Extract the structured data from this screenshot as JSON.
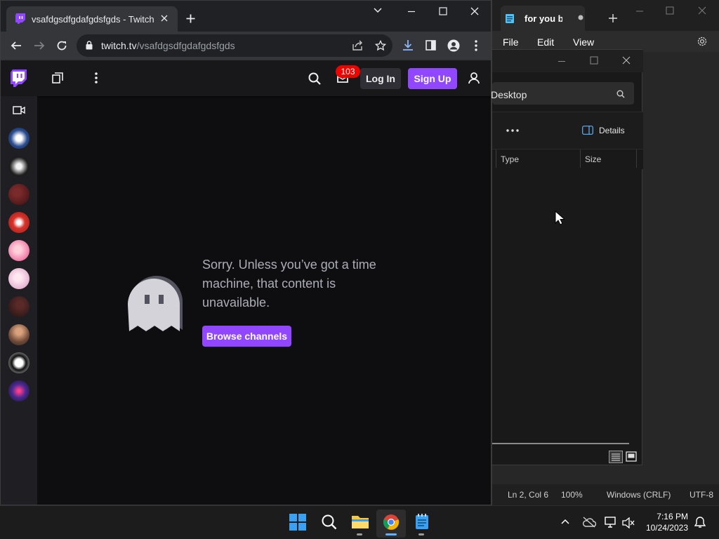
{
  "notepad": {
    "tab_title": "for you bro",
    "menu": {
      "file": "File",
      "edit": "Edit",
      "view": "View"
    },
    "status": {
      "position": "Ln 2, Col 6",
      "zoom": "100%",
      "line_ending": "Windows (CRLF)",
      "encoding": "UTF-8"
    }
  },
  "explorer": {
    "address": "Desktop",
    "toolbar": {
      "details_label": "Details"
    },
    "columns": [
      "Type",
      "Size"
    ]
  },
  "chrome": {
    "tab_title": "vsafdgsdfgdafgdsfgds - Twitch",
    "url_host": "twitch.tv",
    "url_path": "/vsafdgsdfgdafgdsfgds"
  },
  "twitch": {
    "notification_count": "103",
    "login_label": "Log In",
    "signup_label": "Sign Up",
    "message": "Sorry. Unless you’ve got a time machine, that content is unavailable.",
    "browse_label": "Browse channels",
    "accent_color": "#9147ff"
  },
  "taskbar": {
    "time": "7:16 PM",
    "date": "10/24/2023"
  }
}
